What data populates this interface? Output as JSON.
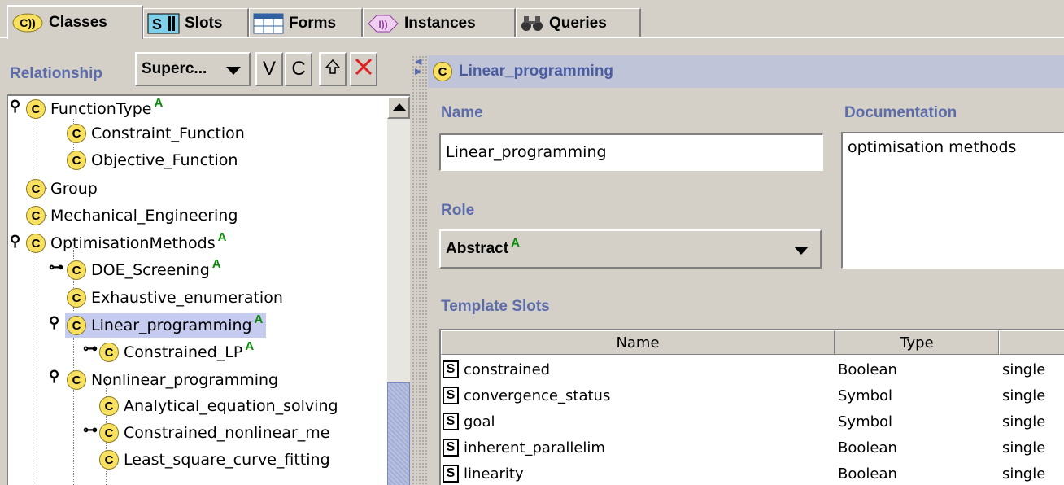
{
  "tabs": [
    {
      "label": "Classes",
      "icon": "classes-icon"
    },
    {
      "label": "Slots",
      "icon": "slots-icon"
    },
    {
      "label": "Forms",
      "icon": "forms-icon"
    },
    {
      "label": "Instances",
      "icon": "instances-icon"
    },
    {
      "label": "Queries",
      "icon": "queries-icon"
    }
  ],
  "left": {
    "relationship_label": "Relationship",
    "relationship_value": "Superc...",
    "buttons": {
      "v": "V",
      "c": "C"
    },
    "tree": [
      {
        "label": "FunctionType",
        "abstract": true
      },
      {
        "label": "Constraint_Function"
      },
      {
        "label": "Objective_Function"
      },
      {
        "label": "Group"
      },
      {
        "label": "Mechanical_Engineering"
      },
      {
        "label": "OptimisationMethods",
        "abstract": true
      },
      {
        "label": "DOE_Screening",
        "abstract": true
      },
      {
        "label": "Exhaustive_enumeration"
      },
      {
        "label": "Linear_programming",
        "abstract": true,
        "selected": true
      },
      {
        "label": "Constrained_LP",
        "abstract": true
      },
      {
        "label": "Nonlinear_programming"
      },
      {
        "label": "Analytical_equation_solving"
      },
      {
        "label": "Constrained_nonlinear_me"
      },
      {
        "label": "Least_square_curve_fitting"
      }
    ],
    "class_glyph": "C",
    "abstract_glyph": "A"
  },
  "right": {
    "title": "Linear_programming",
    "name_label": "Name",
    "name_value": "Linear_programming",
    "doc_label": "Documentation",
    "doc_value": "optimisation methods",
    "role_label": "Role",
    "role_value": "Abstract",
    "slots_label": "Template Slots",
    "columns": [
      "Name",
      "Type",
      ""
    ],
    "rows": [
      {
        "name": "constrained",
        "type": "Boolean",
        "card": "single"
      },
      {
        "name": "convergence_status",
        "type": "Symbol",
        "card": "single"
      },
      {
        "name": "goal",
        "type": "Symbol",
        "card": "single"
      },
      {
        "name": "inherent_parallelim",
        "type": "Boolean",
        "card": "single"
      },
      {
        "name": "linearity",
        "type": "Boolean",
        "card": "single"
      }
    ],
    "slot_glyph": "S"
  },
  "colors": {
    "selection": "#c6cbf0",
    "label_blue": "#5c6ca8",
    "class_icon": "#f8e060",
    "abstract_green": "#0a8a0a"
  }
}
